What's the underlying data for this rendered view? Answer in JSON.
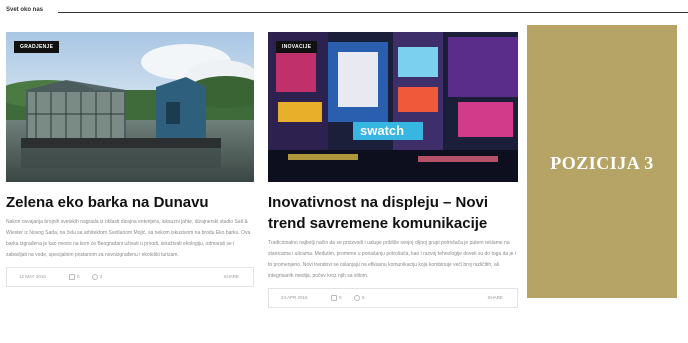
{
  "section": {
    "title": "Svet oko nas"
  },
  "cards": [
    {
      "category": "GRADJENJE",
      "title": "Zelena eko barka na Dunavu",
      "excerpt": "Nakon osvajanja brojnih svetskih nagrada iz oblasti dizajna enterijera, luksuzni jahte, dizajnerski studio Salt & Wiester iz Novog Sada, na čelu sa arhitektom Svetlanom Mojić, sa nekom iskustvom na brodu Eko barku. Ova barka izgrađena je kao mesto na kom će Beograđani uživati u prirodi, istraživati ekologiju, odmarati se i zabavljati na vode, specijalnim pristanom za novoizgrađenu i ekološki turizam.",
      "date": "12 MAY 2016",
      "comments": "0",
      "likes": "2",
      "share": "SHARE"
    },
    {
      "category": "INOVACIJE",
      "title": "Inovativnost na displeju – Novi trend savremene komunikacije",
      "excerpt": "Tradicionalno najbolji način da se proizvodi i usluge približe svojoj ciljnoj grupi potrošača je putem reklame na stanicama i ulicama. Međutim, promene u ponašanju potrošača, kao i razvoj tehnologije doveli su do toga da je i to promenjeno. Novi trendovi se oslanjaju na efikasnu komunikaciju koja kombinuje veći broj različitih, ali integrisanih medija, počev kroz njih sa stilom.",
      "date": "24 APR 2016",
      "comments": "0",
      "likes": "5",
      "share": "SHARE"
    }
  ],
  "ad": {
    "label": "POZICIJA 3",
    "color": "#b5a466"
  },
  "icons": {
    "comment": "comment-icon",
    "like": "heart-icon"
  }
}
